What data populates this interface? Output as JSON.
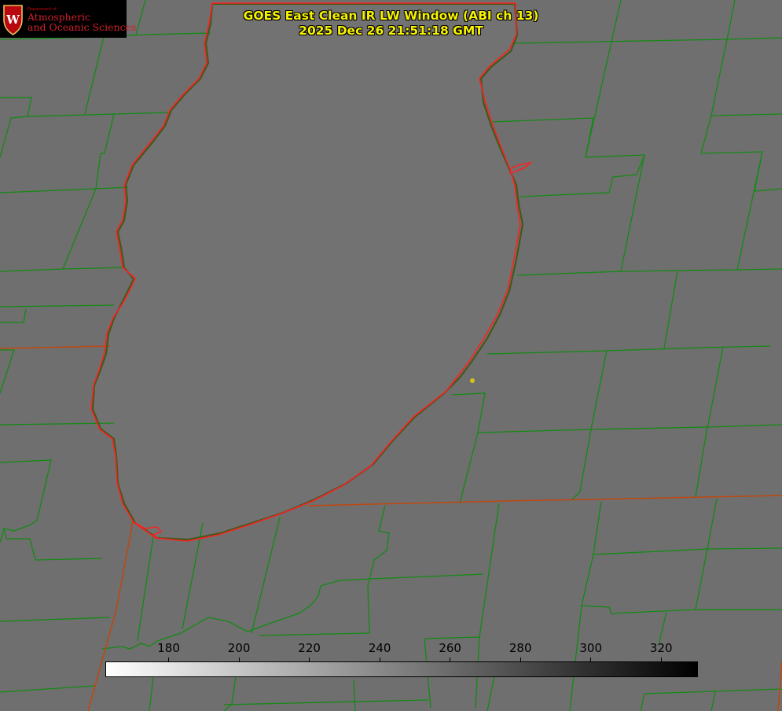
{
  "title": {
    "line1": "GOES East Clean IR LW Window (ABI ch 13)",
    "line2": "2025 Dec 26 21:51:18 GMT"
  },
  "logo": {
    "department": "Department of",
    "line1": "Atmospheric",
    "line2": "and Oceanic Sciences",
    "seal_letter": "W"
  },
  "colorbar": {
    "ticks": [
      "180",
      "200",
      "220",
      "240",
      "260",
      "280",
      "300",
      "320"
    ],
    "range": [
      162,
      330
    ],
    "gradient": "white-to-black"
  },
  "colors": {
    "background_gray": "#6f6f6f",
    "lake_gray": "#727272",
    "county_lines": "#138a13",
    "state_lines": "#c0470f",
    "coastline": "#ff2020",
    "title_text": "#f7f200",
    "marker": "#d4c21a",
    "logo_red": "#c5050c"
  },
  "features": {
    "marker_icon": "yellow-dot-icon",
    "lake": "lake-michigan-outline"
  }
}
